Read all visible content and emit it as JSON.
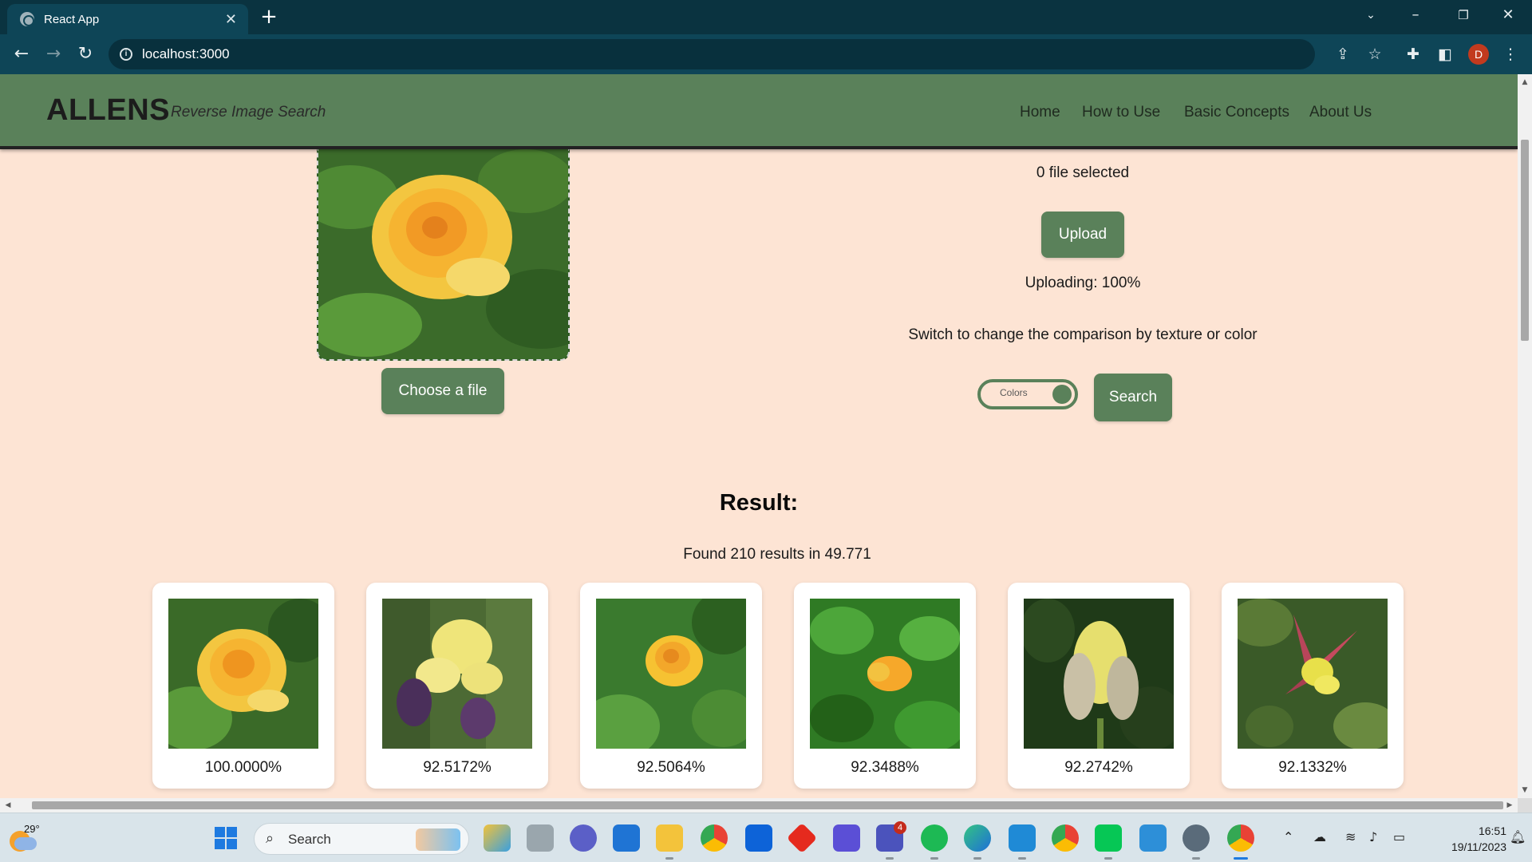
{
  "browser": {
    "tab_title": "React App",
    "url": "localhost:3000",
    "profile_initial": "D"
  },
  "site": {
    "logo": "ALLENS",
    "tagline": "Reverse Image Search",
    "nav": [
      "Home",
      "How to Use",
      "Basic Concepts",
      "About Us"
    ]
  },
  "upload": {
    "choose_label": "Choose a file",
    "file_status": "0 file selected",
    "upload_label": "Upload",
    "progress_text": "Uploading: 100%",
    "progress_fraction": 1.0,
    "switch_hint": "Switch to change the comparison by texture or color",
    "toggle_label": "Colors",
    "search_label": "Search"
  },
  "results": {
    "title": "Result:",
    "summary": "Found 210 results in 49.771",
    "items": [
      {
        "score": "100.0000%",
        "subject": "yellow rose"
      },
      {
        "score": "92.5172%",
        "subject": "yellow iris"
      },
      {
        "score": "92.5064%",
        "subject": "yellow rose"
      },
      {
        "score": "92.3488%",
        "subject": "orange rose bud"
      },
      {
        "score": "92.2742%",
        "subject": "yellow iris bud"
      },
      {
        "score": "92.1332%",
        "subject": "red and yellow columbine"
      }
    ]
  },
  "taskbar": {
    "weather_temp": "29°",
    "search_label": "Search",
    "time": "16:51",
    "date": "19/11/2023",
    "teams_badge": "4"
  },
  "colors": {
    "header_green": "#5a815a",
    "page_background": "#fde4d4",
    "chrome_teal": "#0e4557"
  }
}
